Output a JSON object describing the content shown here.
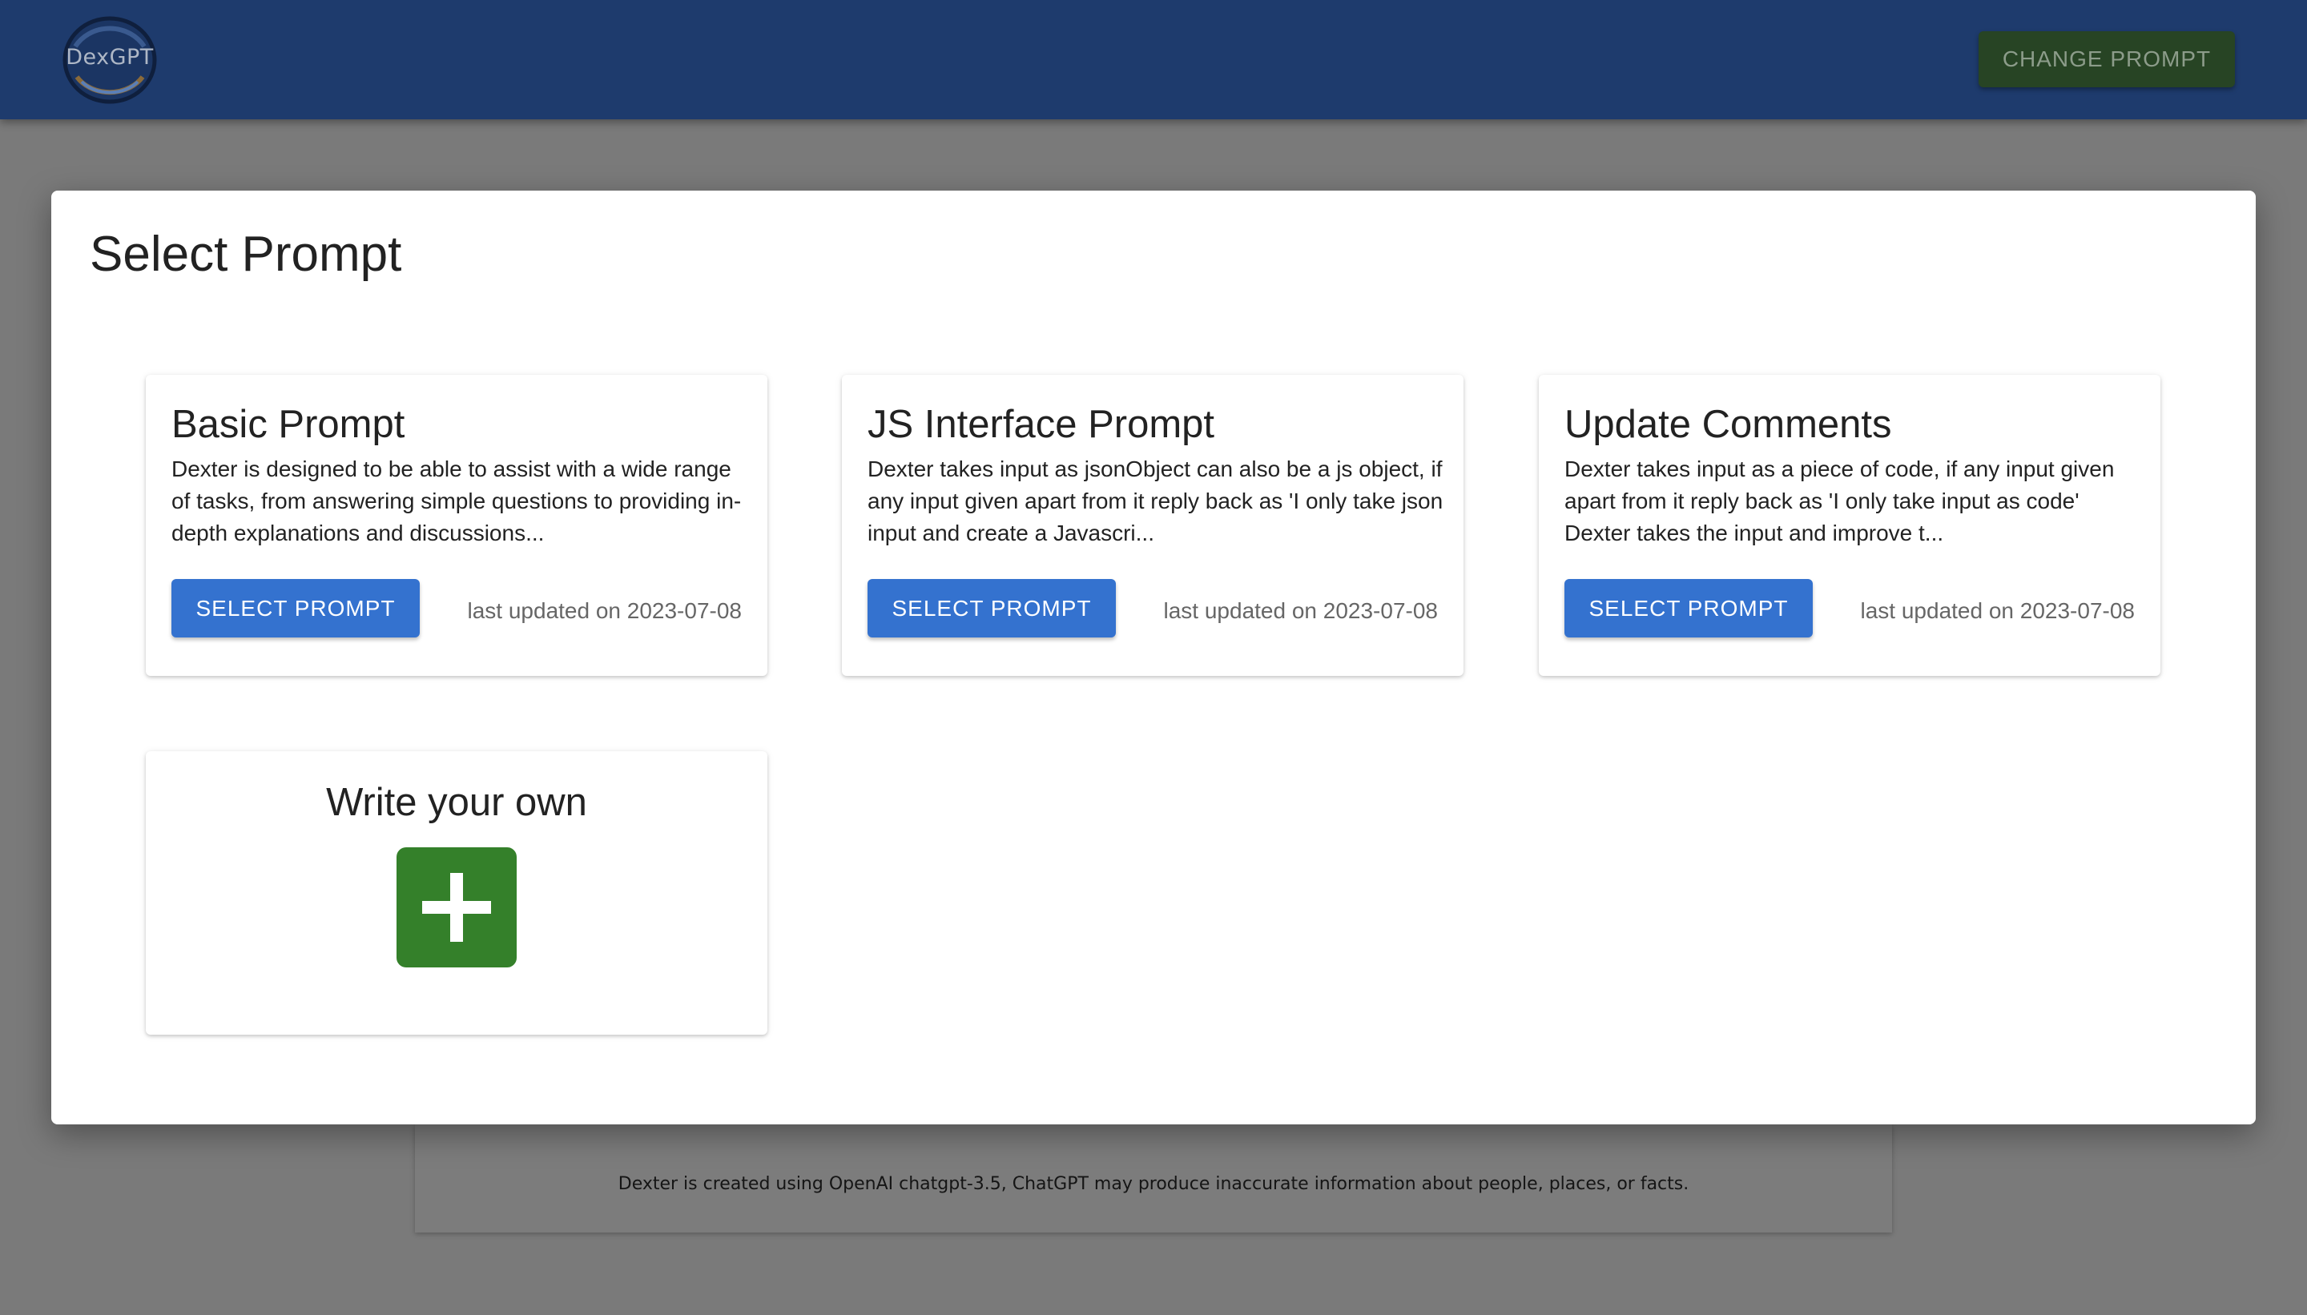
{
  "header": {
    "logo_text": "DexGPT",
    "change_prompt_label": "CHANGE PROMPT"
  },
  "modal": {
    "title": "Select Prompt",
    "cards": [
      {
        "title": "Basic Prompt",
        "description": "Dexter is designed to be able to assist with a wide range of tasks, from answering simple questions to providing in-depth explanations and discussions...",
        "button_label": "SELECT PROMPT",
        "updated": "last updated on 2023-07-08"
      },
      {
        "title": "JS Interface Prompt",
        "description": "Dexter takes input as jsonObject can also be a js object, if any input given apart from it reply back as 'I only take json input and create a Javascri...",
        "button_label": "SELECT PROMPT",
        "updated": "last updated on 2023-07-08"
      },
      {
        "title": "Update Comments",
        "description": "Dexter takes input as a piece of code, if any input given apart from it reply back as 'I only take input as code' Dexter takes the input and improve t...",
        "button_label": "SELECT PROMPT",
        "updated": "last updated on 2023-07-08"
      }
    ],
    "write_own": {
      "title": "Write your own",
      "icon": "plus-icon"
    }
  },
  "footer": {
    "text": "Dexter is created using OpenAI chatgpt-3.5, ChatGPT may produce inaccurate information about people, places, or facts."
  },
  "colors": {
    "header_bg": "#1e3b6d",
    "change_prompt_bg": "#274424",
    "select_button_bg": "#3472cf",
    "add_button_bg": "#34802a",
    "overlay_bg": "#7a7a7a"
  }
}
